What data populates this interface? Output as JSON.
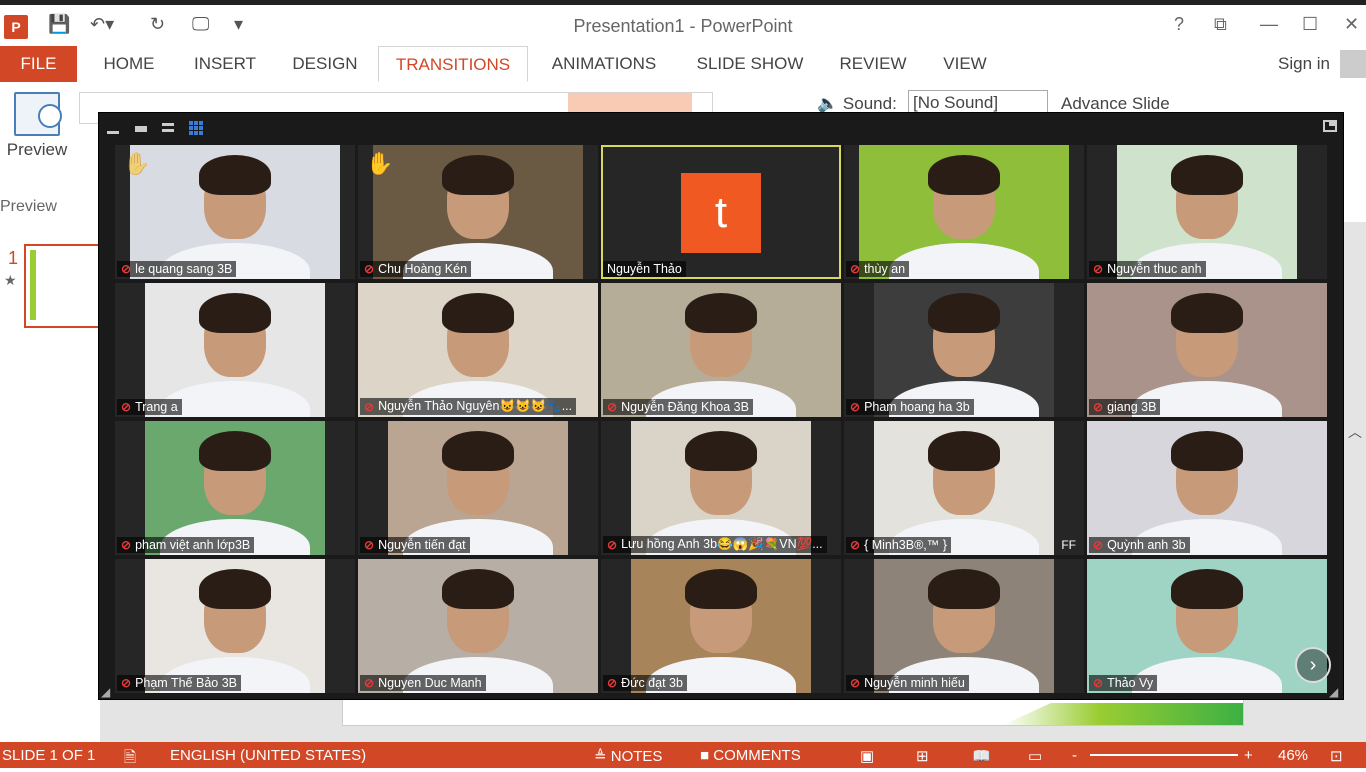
{
  "window": {
    "title": "Presentation1 - PowerPoint",
    "app_icon": "P",
    "help": "?",
    "restore_ribbon": "⧉",
    "minimize": "—",
    "maximize": "☐",
    "close": "✕"
  },
  "qat": {
    "save": "💾",
    "undo": "↶▾",
    "redo": "↻",
    "start": "🖵",
    "customize": "▾"
  },
  "ribbon": {
    "tabs": [
      "FILE",
      "HOME",
      "INSERT",
      "DESIGN",
      "TRANSITIONS",
      "ANIMATIONS",
      "SLIDE SHOW",
      "REVIEW",
      "VIEW"
    ],
    "active_tab": "TRANSITIONS",
    "sign_in": "Sign in",
    "preview_button": "Preview",
    "preview_group": "Preview",
    "sound_label": "Sound:",
    "sound_value": "[No Sound]",
    "advance_label": "Advance Slide"
  },
  "slides_pane": {
    "slide_number": "1",
    "star": "★"
  },
  "status_bar": {
    "slide": "SLIDE 1 OF 1",
    "language": "ENGLISH (UNITED STATES)",
    "notes": "NOTES",
    "comments": "COMMENTS",
    "zoom": "46%",
    "minus": "-",
    "plus": "+"
  },
  "zoom": {
    "next_arrow": "›",
    "participants": [
      {
        "name": "le quang sang 3B",
        "hand": "faded",
        "bg": "#d8dbe2"
      },
      {
        "name": "Chu Hoàng Kén",
        "hand": "yellow",
        "bg": "#6a5a44"
      },
      {
        "name": "Nguyễn Thảo",
        "avatar": "t",
        "active": true
      },
      {
        "name": "thùy an",
        "bg": "#8fbf3a"
      },
      {
        "name": "Nguyễn thuc anh",
        "bg": "#cfe3cc"
      },
      {
        "name": "Trang a",
        "bg": "#e6e6e6"
      },
      {
        "name": "Nguyễn Thảo Nguyên😺😺😺🐾...",
        "bg": "#ddd6c8"
      },
      {
        "name": "Nguyễn Đăng Khoa 3B",
        "bg": "#b6ad98"
      },
      {
        "name": "Pham hoang ha 3b",
        "bg": "#3d3d3d"
      },
      {
        "name": "giang 3B",
        "bg": "#a9938a"
      },
      {
        "name": "pham việt anh lớp3B",
        "bg": "#6aa86e"
      },
      {
        "name": "Nguyễn tiến đạt",
        "bg": "#b9a592"
      },
      {
        "name": "Lưu hồng Anh 3b😂😱🎉💐VN💯...",
        "bg": "#d9d3c8"
      },
      {
        "name": "{ Minh3B®,™ }",
        "bg": "#e4e2dd",
        "badge": "FF"
      },
      {
        "name": "Quỳnh anh 3b",
        "bg": "#d6d6dc"
      },
      {
        "name": "Phạm Thế Bảo 3B",
        "bg": "#e9e6e2"
      },
      {
        "name": "Nguyen Duc Manh",
        "bg": "#b7afa5"
      },
      {
        "name": "Đức đạt 3b",
        "bg": "#a8845a"
      },
      {
        "name": "Nguyễn minh hiếu",
        "bg": "#8e8378"
      },
      {
        "name": "Thảo Vy",
        "bg": "#9fd3c4"
      }
    ]
  }
}
